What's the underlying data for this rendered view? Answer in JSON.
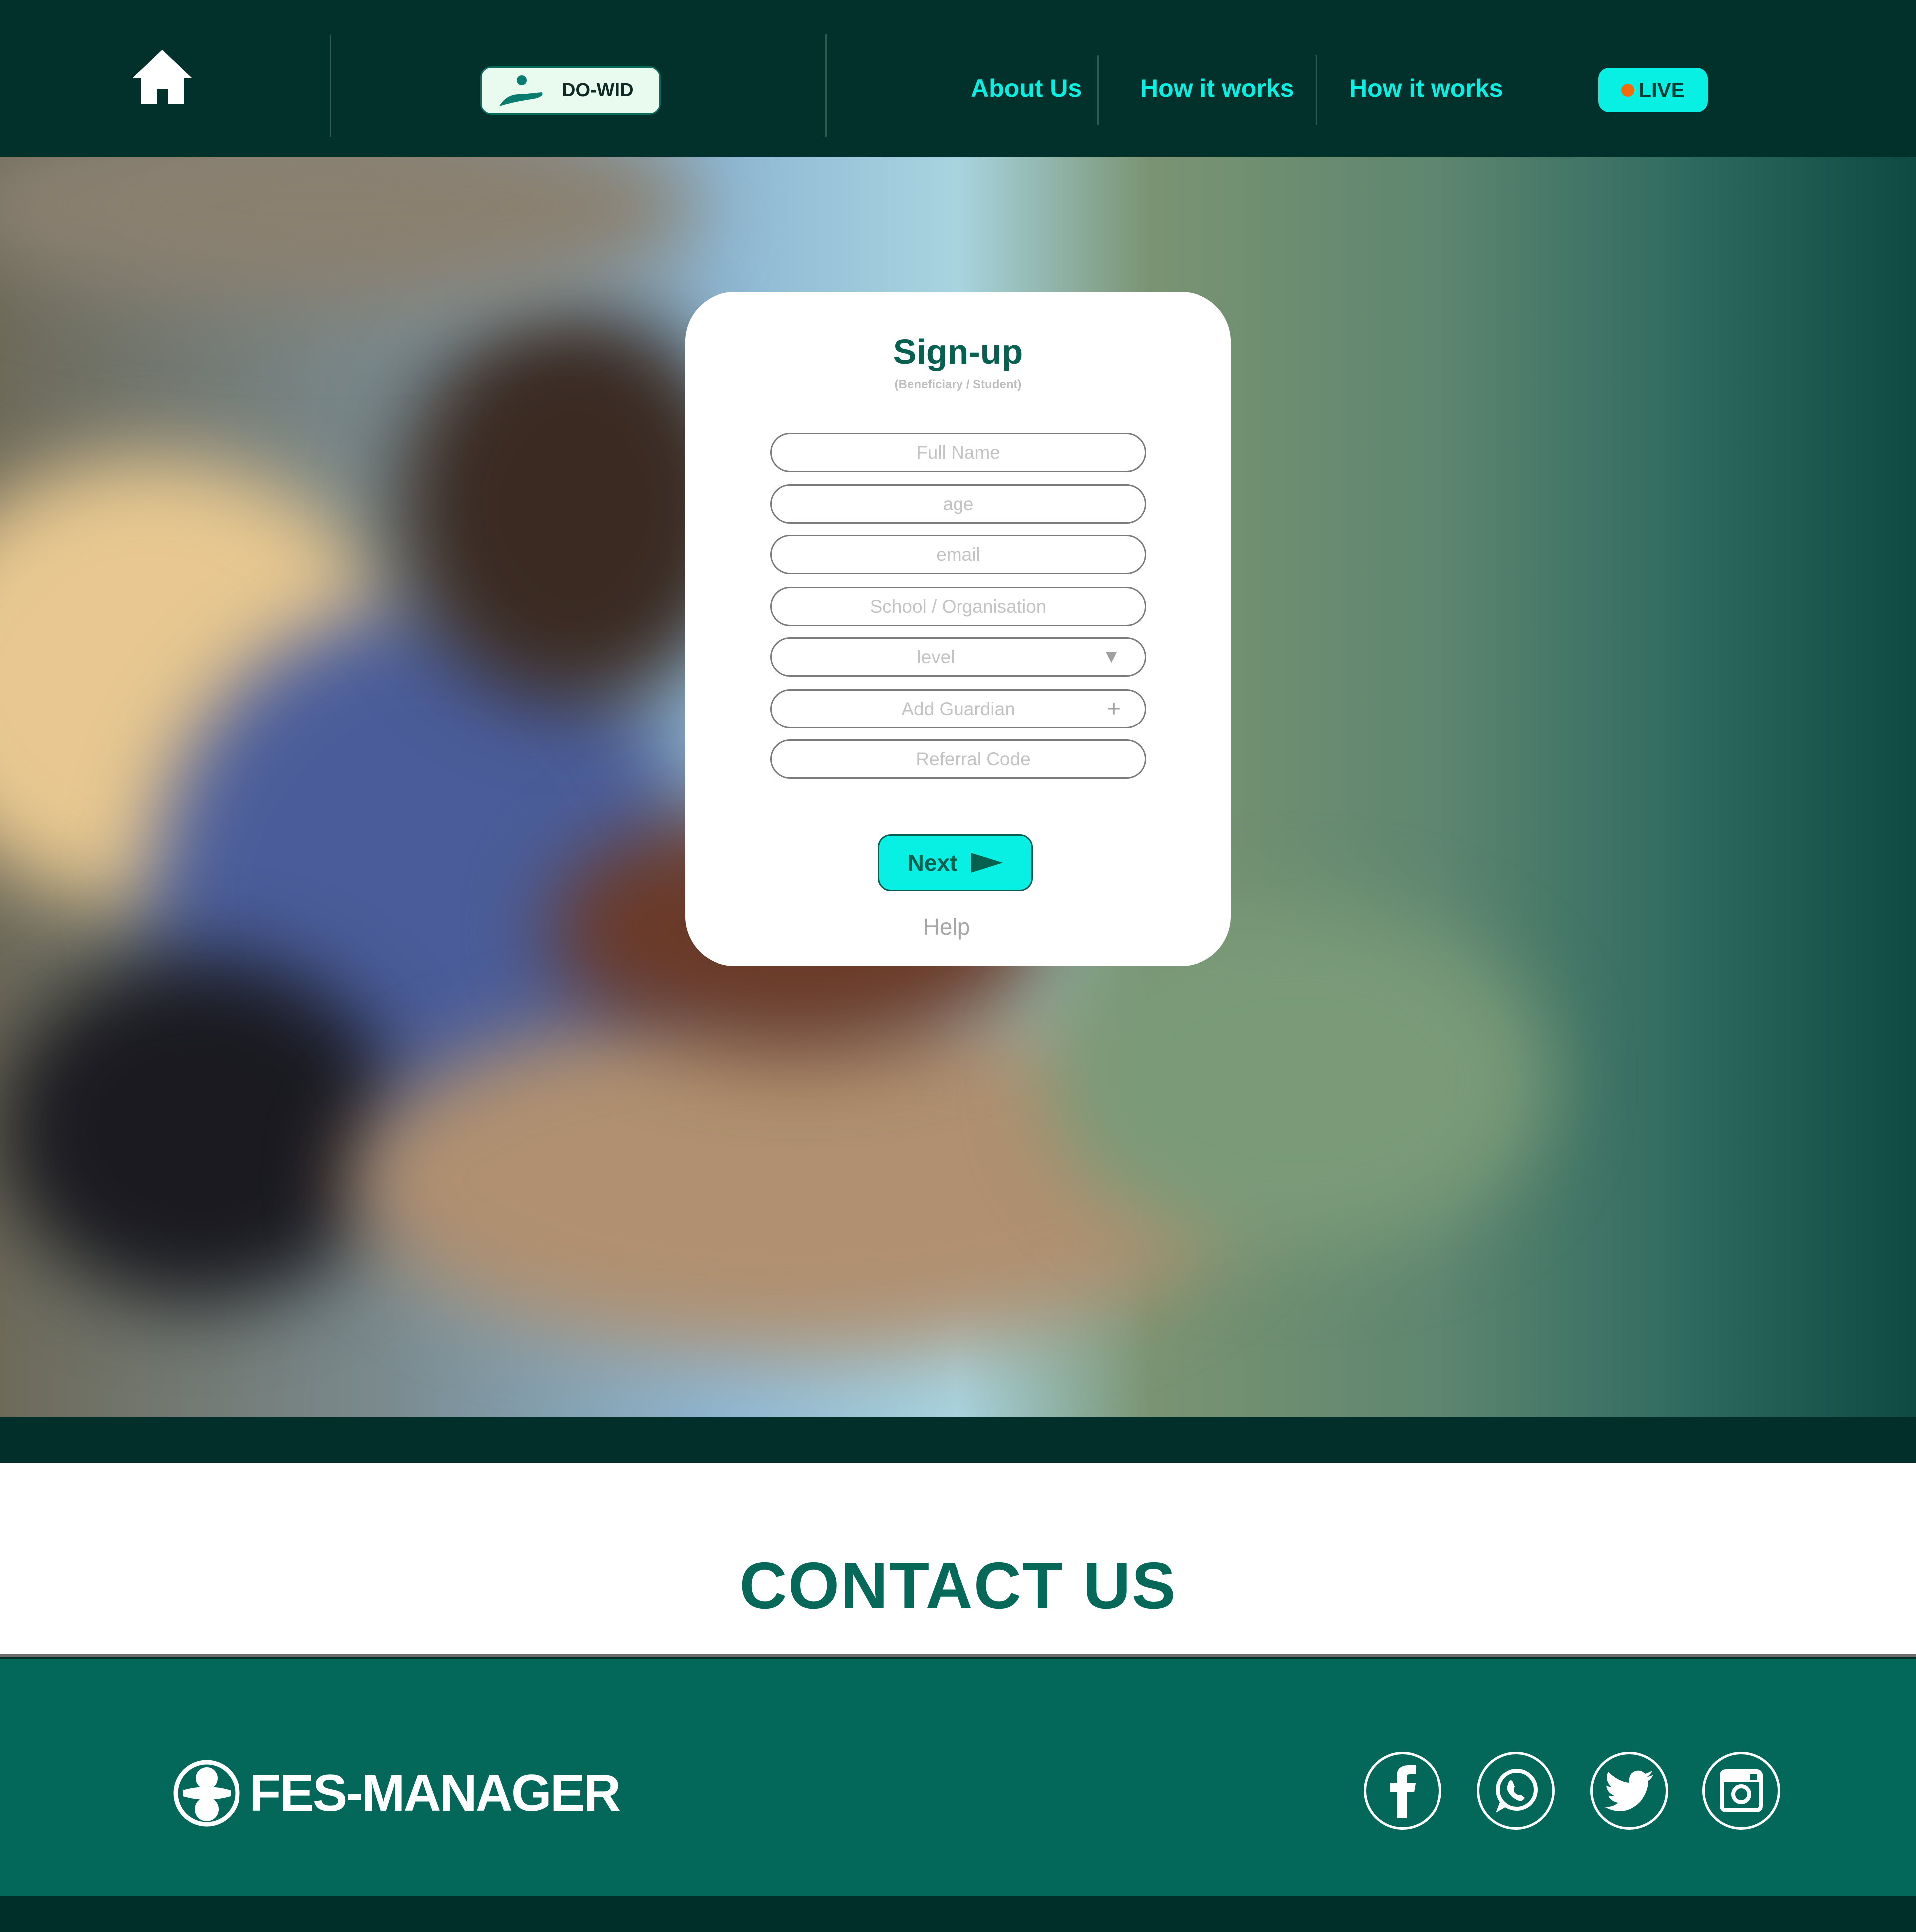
{
  "header": {
    "brand_button": "DO-WID",
    "nav": [
      "About Us",
      "How it works",
      "How it works"
    ],
    "live_label": "LIVE"
  },
  "signup": {
    "title": "Sign-up",
    "subtitle": "(Beneficiary / Student)",
    "fields": {
      "full_name": "Full Name",
      "age": "age",
      "email": "email",
      "school": "School / Organisation",
      "level": "level",
      "guardian": "Add Guardian",
      "referral": "Referral Code"
    },
    "next_label": "Next",
    "help_label": "Help"
  },
  "contact": {
    "title": "CONTACT US"
  },
  "footer": {
    "brand": "FES-MANAGER",
    "socials": [
      "facebook-icon",
      "whatsapp-icon",
      "twitter-icon",
      "instagram-icon"
    ]
  },
  "colors": {
    "header_bg": "#02302b",
    "accent": "#08f0e4",
    "brand_green": "#036859",
    "live_dot": "#f06a10"
  }
}
